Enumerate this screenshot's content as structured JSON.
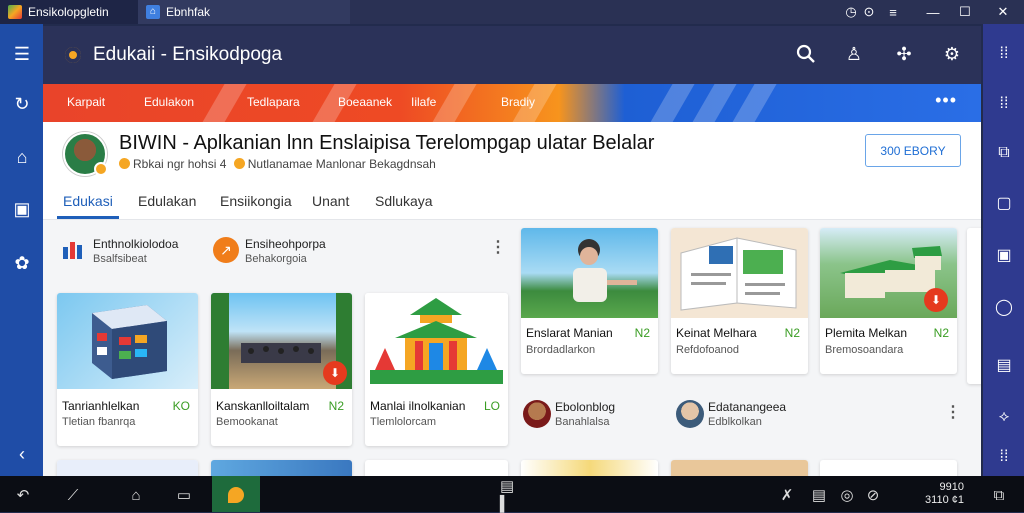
{
  "window": {
    "tabs": [
      {
        "label": "Ensikolopgletin",
        "icon": "app-logo-icon"
      },
      {
        "label": "Ebnhfak",
        "icon": "home-icon"
      }
    ],
    "controls": [
      "clock-icon",
      "menu-icon",
      "minimize-icon",
      "maximize-icon",
      "close-icon"
    ]
  },
  "app": {
    "title": "Edukaii - Ensikodpoga",
    "actions": [
      "search-icon",
      "user-icon",
      "share-icon",
      "settings-icon"
    ]
  },
  "left_nav": [
    "menu-icon",
    "refresh-icon",
    "home-icon",
    "lock-icon",
    "gear-icon",
    "back-icon"
  ],
  "right_nav": [
    "grid-icon",
    "grid-icon",
    "copy-icon",
    "chat-icon",
    "window-icon",
    "circle-icon",
    "note-icon",
    "compass-icon",
    "grid-icon"
  ],
  "ribbon": {
    "items": [
      "Karpait",
      "Edulakon",
      "Tedlapara",
      "Boeaanek",
      "Iilafe",
      "Bradiy"
    ],
    "colors": {
      "start": "#e9442a",
      "middle": "#f7941d",
      "end": "#2a6ee6"
    }
  },
  "header": {
    "title": "BIWIN - Aplkanian lnn Enslaipisa Terelompgap ulatar Belalar",
    "subtitle_a": "Rbkai ngr hohsi 4",
    "subtitle_b": "Nutlanamae Manlonar Bekagdnsah",
    "subscribe_label": "300 EBORY"
  },
  "tabs": [
    {
      "label": "Edukasi",
      "active": true
    },
    {
      "label": "Edulakan",
      "active": false
    },
    {
      "label": "Ensiikongia",
      "active": false
    },
    {
      "label": "Unant",
      "active": false
    },
    {
      "label": "Sdlukaya",
      "active": false
    }
  ],
  "channels": [
    {
      "name": "Enthnolkiolodoa",
      "sub": "Bsalfsibeat",
      "icon": "chart-icon"
    },
    {
      "name": "Ensiheohporpa",
      "sub": "Behakorgoia",
      "icon": "arrow-icon"
    }
  ],
  "cards_row1": [
    {
      "title": "Tanrianhlelkan",
      "sub": "Tletian fbanrqa",
      "badge": "KO",
      "thumb": "cube-thumbnail"
    },
    {
      "title": "Kanskanlloiltalam",
      "sub": "Bemookanat",
      "badge": "N2",
      "thumb": "crowd-thumbnail"
    },
    {
      "title": "Manlai ilnolkanian",
      "sub": "Tlemlolorcam",
      "badge": "LO",
      "thumb": "temple-thumbnail"
    }
  ],
  "cards_right": [
    {
      "title": "Enslarat Manian",
      "sub": "Brordadlarkon",
      "badge": "N2",
      "thumb": "student-thumbnail"
    },
    {
      "title": "Keinat Melhara",
      "sub": "Refdofoanod",
      "badge": "N2",
      "thumb": "book-thumbnail"
    },
    {
      "title": "Plemita Melkan",
      "sub": "Bremosoandara",
      "badge": "N2",
      "thumb": "school-thumbnail"
    }
  ],
  "channels_right": [
    {
      "name": "Ebolonblog",
      "sub": "Banahlalsa",
      "icon": "avatar-icon"
    },
    {
      "name": "Edatanangeea",
      "sub": "Edblkolkan",
      "icon": "avatar-icon"
    }
  ],
  "taskbar": {
    "icons": [
      "back-icon",
      "pen-icon",
      "home-icon",
      "window-icon",
      "app-icon",
      "media-icon",
      "pin-icon",
      "chat-icon",
      "at-icon",
      "cancel-icon",
      "screen-icon"
    ],
    "clock_time": "9910",
    "clock_date": "3110 ¢1"
  }
}
